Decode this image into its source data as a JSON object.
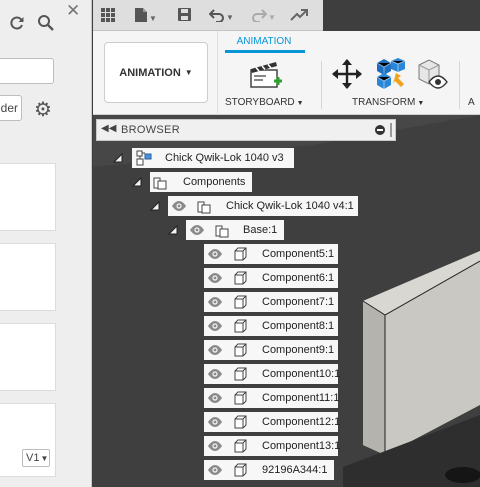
{
  "left_panel": {
    "button_label": "der",
    "version_label": "V1",
    "icons": [
      "refresh-icon",
      "search-icon",
      "close-icon",
      "gear-icon"
    ]
  },
  "quick_access": {
    "icons": [
      "grid-icon",
      "file-icon",
      "save-icon",
      "undo-icon",
      "redo-icon",
      "job-status-icon"
    ]
  },
  "ribbon": {
    "workspace_label": "ANIMATION",
    "active_tab": "ANIMATION",
    "groups": [
      {
        "label": "STORYBOARD",
        "icon": "storyboard-clapper-icon"
      },
      {
        "label": "TRANSFORM",
        "icon": "transform-move-icon"
      },
      {
        "label": "A",
        "icon": "view-icon"
      }
    ]
  },
  "browser": {
    "title": "BROWSER",
    "root": "Chick Qwik-Lok 1040 v3",
    "components_folder": "Components",
    "assembly": "Chick Qwik-Lok 1040 v4:1",
    "base": "Base:1",
    "items": [
      "Component5:1",
      "Component6:1",
      "Component7:1",
      "Component8:1",
      "Component9:1",
      "Component10:1",
      "Component11:1",
      "Component12:1",
      "Component13:1",
      "92196A344:1"
    ]
  },
  "colors": {
    "accent": "#0696d7",
    "viewport_bg": "#3e3e3e",
    "panel_bg": "#eeeeee"
  }
}
